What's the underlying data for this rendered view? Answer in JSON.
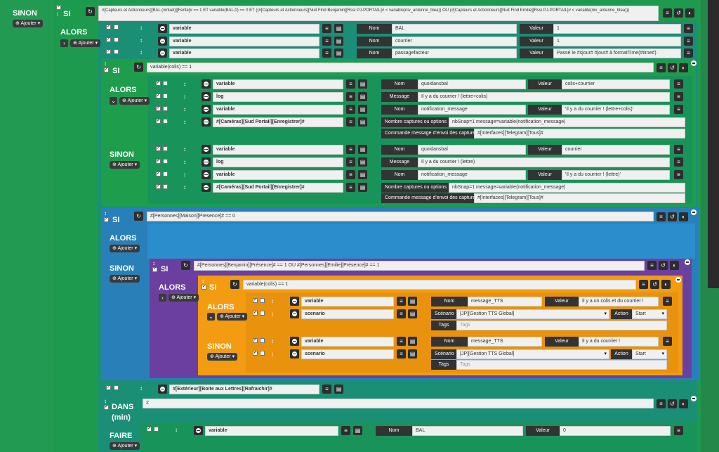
{
  "outer": {
    "sinon_label": "SINON",
    "ajouter": "Ajouter",
    "si_label": "SI",
    "alors_label": "ALORS",
    "condition": "#[Capteurs et Actionneurs][BAL (virtuel)][Fente]# == 1 ET variable(BAL,0) == 0 ET ((#[Capteurs et Actionneurs][Nuit Find Benjamin][Rssi PJ-PORTAIL]# < variable(niv_antenne_blea)) OU (#[Capteurs et Actionneurs][Nuit Find Emilie][Rssi PJ-PORTAIL]# < variable(niv_antenne_blea)))",
    "actions": [
      {
        "type": "variable",
        "nom_label": "Nom",
        "nom": "BAL",
        "val_label": "Valeur",
        "val": "1"
      },
      {
        "type": "variable",
        "nom_label": "Nom",
        "nom": "courrier",
        "val_label": "Valeur",
        "val": "1"
      },
      {
        "type": "variable",
        "nom_label": "Nom",
        "nom": "passagefacteur",
        "val_label": "Valeur",
        "val": "Passé le #sjour# #jour# à formatTime(#time#)"
      }
    ]
  },
  "colis": {
    "si_label": "SI",
    "condition": "variable(colis) == 1",
    "alors_label": "ALORS",
    "sinon_label": "SINON",
    "ajouter": "Ajouter",
    "alors_actions": [
      {
        "type": "variable",
        "l1": "Nom",
        "v1": "quoidansbal",
        "l2": "Valeur",
        "v2": "colis+courrier"
      },
      {
        "type": "log",
        "l1": "Message",
        "v1": "Il y a du courrier ! (lettre+colis)"
      },
      {
        "type": "variable",
        "l1": "Nom",
        "v1": "notification_message",
        "l2": "Valeur",
        "v2": "'Il y a du courrier ! (lettre+colis)'"
      },
      {
        "type": "#[Caméras][Sud Portail][Enregistrer]#",
        "l1": "Nombre captures ou options",
        "v1": "nbSnap=1 message=variable(notification_message)",
        "l3": "Commande message d'envoi des captures",
        "v3": "#[Interfaces][Telegram][Tous]#"
      }
    ],
    "sinon_actions": [
      {
        "type": "variable",
        "l1": "Nom",
        "v1": "quoidansbal",
        "l2": "Valeur",
        "v2": "courrier"
      },
      {
        "type": "log",
        "l1": "Message",
        "v1": "Il y a du courrier ! (lettre)"
      },
      {
        "type": "variable",
        "l1": "Nom",
        "v1": "notification_message",
        "l2": "Valeur",
        "v2": "'Il y a du courrier ! (lettre)'"
      },
      {
        "type": "#[Caméras][Sud Portail][Enregistrer]#",
        "l1": "Nombre captures ou options",
        "v1": "nbSnap=1 message=variable(notification_message)",
        "l3": "Commande message d'envoi des captures",
        "v3": "#[Interfaces][Telegram][Tous]#"
      }
    ]
  },
  "presence": {
    "si_label": "SI",
    "condition": "#[Personnes][Maison][Presence]# == 0",
    "alors_label": "ALORS",
    "sinon_label": "SINON",
    "ajouter": "Ajouter"
  },
  "inner": {
    "si_label": "SI",
    "condition": "#[Personnes][Benjamin][Présence]# == 1 OU #[Personnes][Emilie][Présence]# == 1",
    "alors_label": "ALORS",
    "ajouter": "Ajouter"
  },
  "tts": {
    "si_label": "SI",
    "condition": "variable(colis) == 1",
    "alors_label": "ALORS",
    "sinon_label": "SINON",
    "ajouter": "Ajouter",
    "alors": {
      "var_type": "variable",
      "nom_label": "Nom",
      "nom": "message_TTS",
      "val_label": "Valeur",
      "val": "Il y a un colis et du courrier !",
      "scen_type": "scenario",
      "scen_label": "Scénario",
      "scen": "[JP][Gestion TTS Global]",
      "action_label": "Action",
      "action": "Start",
      "tags_label": "Tags",
      "tags_ph": "Tags"
    },
    "sinon": {
      "var_type": "variable",
      "nom_label": "Nom",
      "nom": "message_TTS",
      "val_label": "Valeur",
      "val": "Il y a du courrier !",
      "scen_type": "scenario",
      "scen_label": "Scénario",
      "scen": "[JP][Gestion TTS Global]",
      "action_label": "Action",
      "action": "Start",
      "tags_label": "Tags",
      "tags_ph": "Tags"
    }
  },
  "refresh": {
    "cmd": "#[Extérieur][Boite aux Lettres][Rafraichir]#"
  },
  "dans": {
    "label": "DANS",
    "unit": "(min)",
    "value": "2"
  },
  "faire": {
    "label": "FAIRE",
    "ajouter": "Ajouter",
    "type": "variable",
    "nom_label": "Nom",
    "nom": "BAL",
    "val_label": "Valeur",
    "val": "0"
  },
  "colors": {
    "green": "#1e9a4f",
    "teal": "#16a085",
    "blue": "#2c7fb8",
    "purple": "#6b3fa0",
    "orange": "#f39c12"
  }
}
